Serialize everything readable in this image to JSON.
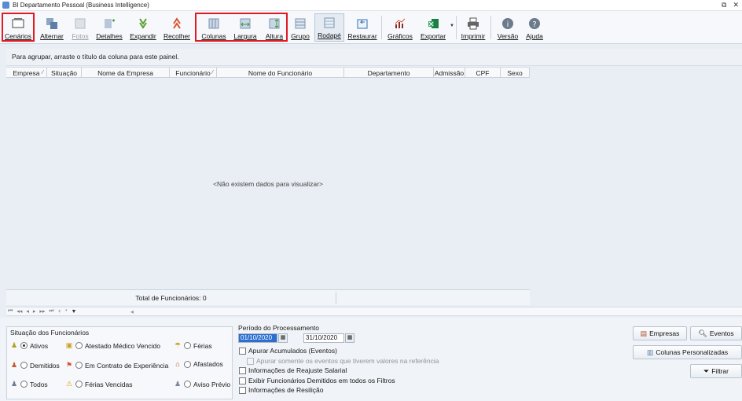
{
  "window": {
    "title": "BI Departamento Pessoal  (Business Intelligence)"
  },
  "toolbar": {
    "items": [
      {
        "label": "Cenários",
        "icon": "scenario-icon"
      },
      {
        "label": "Alternar",
        "icon": "switch-icon"
      },
      {
        "label": "Fotos",
        "icon": "photo-icon",
        "disabled": true
      },
      {
        "label": "Detalhes",
        "icon": "details-icon"
      },
      {
        "label": "Expandir",
        "icon": "expand-icon"
      },
      {
        "label": "Recolher",
        "icon": "collapse-icon"
      },
      {
        "label": "Colunas",
        "icon": "columns-icon"
      },
      {
        "label": "Largura",
        "icon": "width-icon"
      },
      {
        "label": "Altura",
        "icon": "height-icon"
      },
      {
        "label": "Grupo",
        "icon": "group-icon"
      },
      {
        "label": "Rodapé",
        "icon": "footer-icon",
        "active": true
      },
      {
        "label": "Restaurar",
        "icon": "restore-icon"
      },
      {
        "label": "Gráficos",
        "icon": "chart-icon"
      },
      {
        "label": "Exportar",
        "icon": "export-icon"
      },
      {
        "label": "Imprimir",
        "icon": "print-icon"
      },
      {
        "label": "Versão",
        "icon": "info-icon"
      },
      {
        "label": "Ajuda",
        "icon": "help-icon"
      }
    ],
    "highlight_color": "#e01b22"
  },
  "grid": {
    "group_panel_text": "Para agrupar, arraste o título da coluna para este painel.",
    "columns": [
      "Empresa",
      "Situação",
      "Nome da Empresa",
      "Funcionário",
      "Nome do Funcionário",
      "Departamento",
      "Admissão",
      "CPF",
      "Sexo"
    ],
    "empty_text": "<Não existem dados para visualizar>",
    "footer_total": "Total de Funcionários: 0"
  },
  "status_panel": {
    "title": "Situação dos Funcionários",
    "options": [
      {
        "label": "Ativos",
        "selected": true,
        "icon": "person-icon"
      },
      {
        "label": "Demitidos",
        "selected": false,
        "icon": "person-icon"
      },
      {
        "label": "Todos",
        "selected": false,
        "icon": "people-icon"
      },
      {
        "label": "Atestado Médico Vencido",
        "selected": false,
        "icon": "medical-icon"
      },
      {
        "label": "Em Contrato de Experiência",
        "selected": false,
        "icon": "flag-icon"
      },
      {
        "label": "Férias Vencidas",
        "selected": false,
        "icon": "warning-icon"
      },
      {
        "label": "Férias",
        "selected": false,
        "icon": "beach-icon"
      },
      {
        "label": "Afastados",
        "selected": false,
        "icon": "home-icon"
      },
      {
        "label": "Aviso Prévio",
        "selected": false,
        "icon": "person-x-icon"
      }
    ]
  },
  "period": {
    "title": "Período do Processamento",
    "start": "01/10/2020",
    "end": "31/10/2020",
    "options": [
      {
        "label": "Apurar Acumulados (Eventos)",
        "checked": false,
        "disabled": false
      },
      {
        "label": "Apurar somente os eventos que tiverem valores na referência",
        "checked": false,
        "disabled": true
      },
      {
        "label": "Informações de Reajuste Salarial",
        "checked": false,
        "disabled": false
      },
      {
        "label": "Exibir Funcionários Demitidos em todos os Filtros",
        "checked": false,
        "disabled": false
      },
      {
        "label": "Informações de Resilição",
        "checked": false,
        "disabled": false
      }
    ]
  },
  "actions": {
    "empresas": "Empresas",
    "eventos": "Eventos",
    "colunas": "Colunas Personalizadas",
    "filtrar": "Filtrar"
  }
}
